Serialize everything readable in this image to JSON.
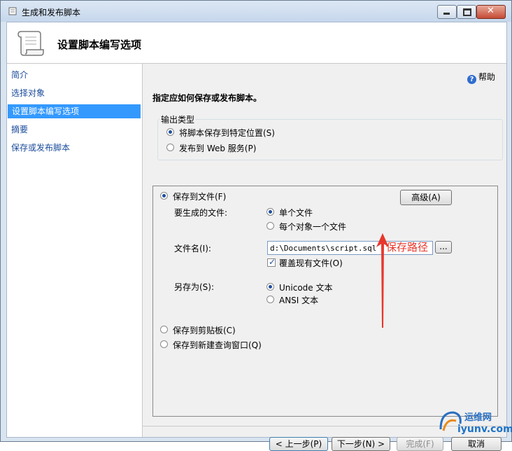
{
  "window": {
    "title": "生成和发布脚本"
  },
  "header": {
    "title": "设置脚本编写选项"
  },
  "nav": {
    "items": [
      {
        "label": "简介"
      },
      {
        "label": "选择对象"
      },
      {
        "label": "设置脚本编写选项",
        "selected": true
      },
      {
        "label": "摘要"
      },
      {
        "label": "保存或发布脚本"
      }
    ]
  },
  "content": {
    "help_label": "帮助",
    "instruction": "指定应如何保存或发布脚本。",
    "output_type": {
      "label": "输出类型",
      "option_save": "将脚本保存到特定位置(S)",
      "option_publish": "发布到 Web 服务(P)"
    },
    "save_to_file": {
      "label": "保存到文件(F)",
      "advanced_button": "高级(A)",
      "files_to_generate": {
        "label": "要生成的文件:",
        "single_file": "单个文件",
        "per_object": "每个对象一个文件"
      },
      "filename": {
        "label": "文件名(I):",
        "value": "d:\\Documents\\script.sql",
        "browse_button": "..."
      },
      "overwrite_label": "覆盖现有文件(O)",
      "save_as": {
        "label": "另存为(S):",
        "unicode": "Unicode 文本",
        "ansi": "ANSI 文本"
      }
    },
    "clipboard_label": "保存到剪贴板(C)",
    "new_query_label": "保存到新建查询窗口(Q)",
    "annotation": "保存路径"
  },
  "footer": {
    "prev_button": "< 上一步(P)",
    "next_button": "下一步(N) >",
    "finish_button": "完成(F)",
    "cancel_button": "取消"
  },
  "watermark": {
    "line1": "运维网",
    "line2": "iyunv.com"
  },
  "colors": {
    "accent": "#3399ff",
    "annotation": "#e8372d",
    "link": "#1a4b9b"
  }
}
